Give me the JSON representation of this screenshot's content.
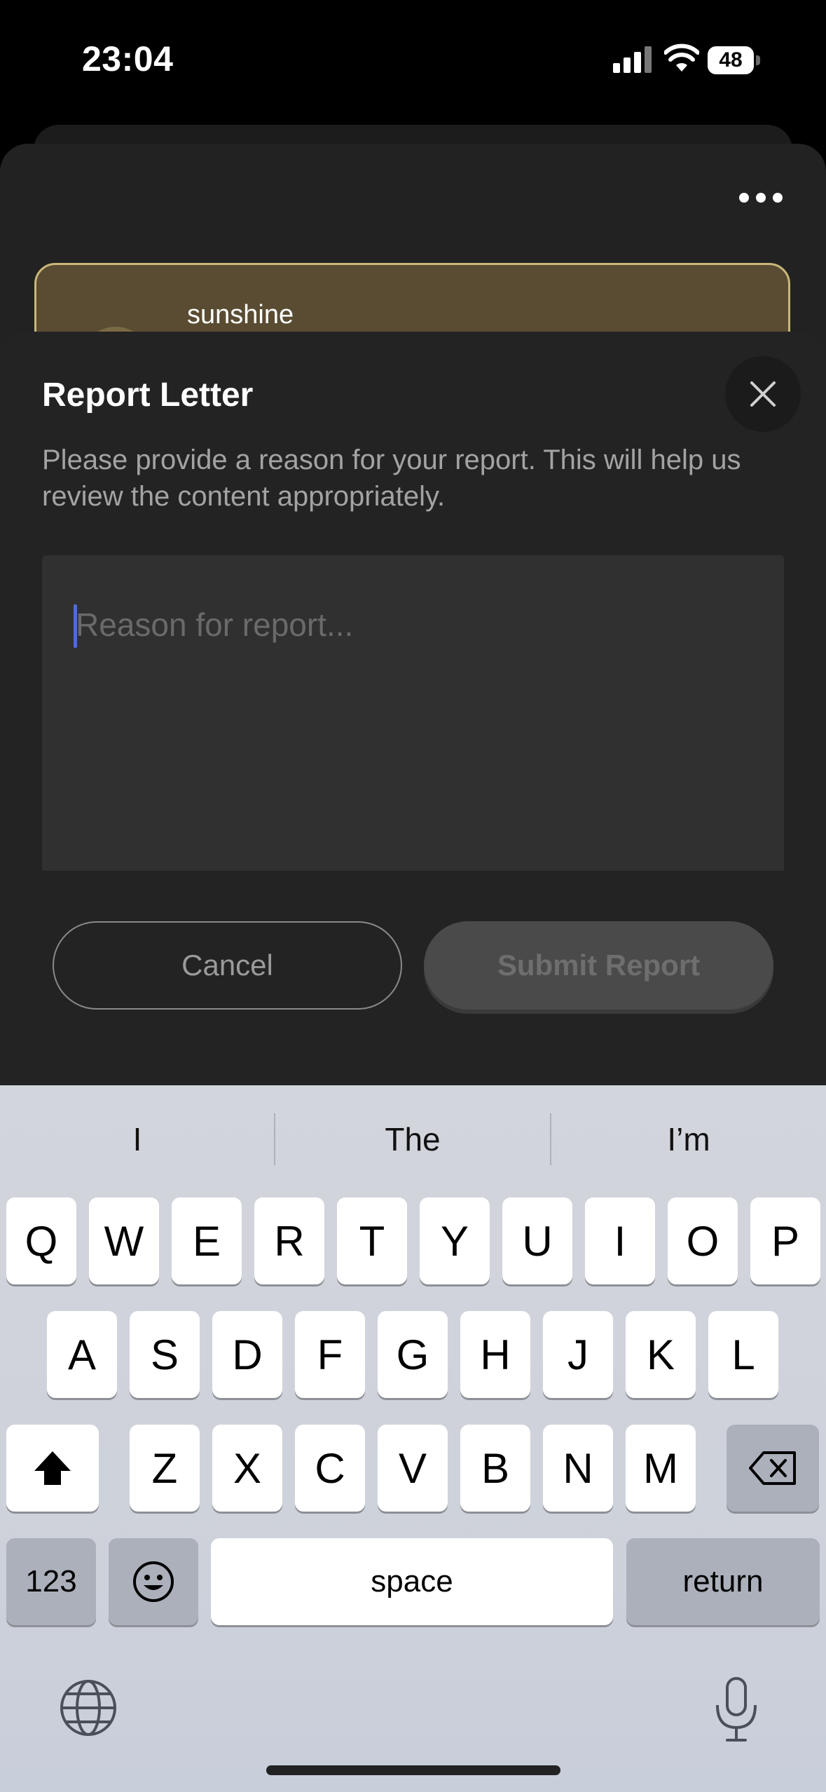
{
  "status_bar": {
    "time": "23:04",
    "battery": "48"
  },
  "background": {
    "letter_author": "sunshine"
  },
  "report_sheet": {
    "title": "Report Letter",
    "description": "Please provide a reason for your report. This will help us review the content appropriately.",
    "textarea_placeholder": "Reason for report...",
    "cancel_label": "Cancel",
    "submit_label": "Submit Report"
  },
  "keyboard": {
    "suggestions": [
      "I",
      "The",
      "I’m"
    ],
    "row1": [
      "Q",
      "W",
      "E",
      "R",
      "T",
      "Y",
      "U",
      "I",
      "O",
      "P"
    ],
    "row2": [
      "A",
      "S",
      "D",
      "F",
      "G",
      "H",
      "J",
      "K",
      "L"
    ],
    "row3": [
      "Z",
      "X",
      "C",
      "V",
      "B",
      "N",
      "M"
    ],
    "numbers_label": "123",
    "space_label": "space",
    "return_label": "return"
  },
  "icons": {
    "more": "ellipsis-icon",
    "close": "close-icon",
    "shift": "shift-icon",
    "backspace": "backspace-icon",
    "emoji": "emoji-icon",
    "globe": "globe-icon",
    "mic": "microphone-icon"
  },
  "colors": {
    "accent": "#4f6bd6",
    "card_fill": "#5a4c32",
    "card_border": "#c9b77a"
  }
}
